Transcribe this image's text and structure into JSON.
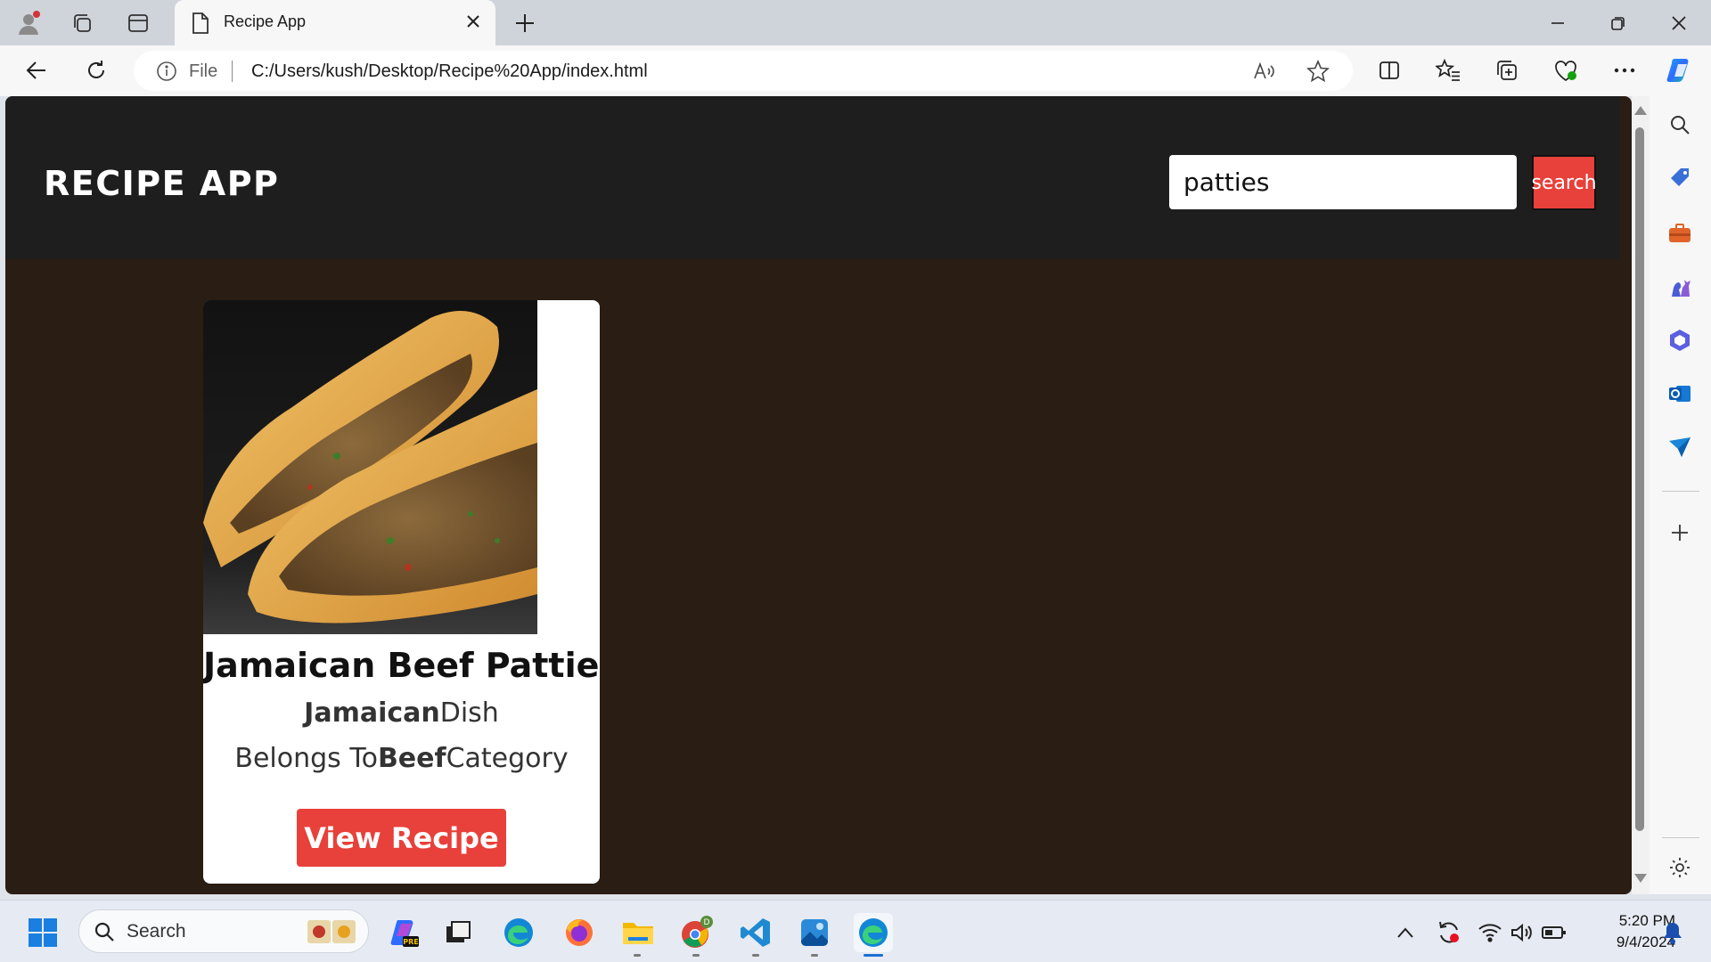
{
  "browser": {
    "tab_title": "Recipe App",
    "url_scheme_label": "File",
    "url": "C:/Users/kush/Desktop/Recipe%20App/index.html"
  },
  "app": {
    "title": "RECIPE APP",
    "search": {
      "value": "patties",
      "button_label": "search"
    }
  },
  "recipes": [
    {
      "name": "Jamaican Beef Patties",
      "area": "Jamaican",
      "area_suffix": "Dish",
      "category_prefix": "Belongs To",
      "category": "Beef",
      "category_suffix": "Category",
      "button_label": "View Recipe"
    }
  ],
  "taskbar": {
    "search_label": "Search",
    "time": "5:20 PM",
    "date": "9/4/2024"
  },
  "colors": {
    "accent_red": "#e8403a",
    "header_bg": "#1e1e1e",
    "page_bg": "#2a1d13"
  }
}
